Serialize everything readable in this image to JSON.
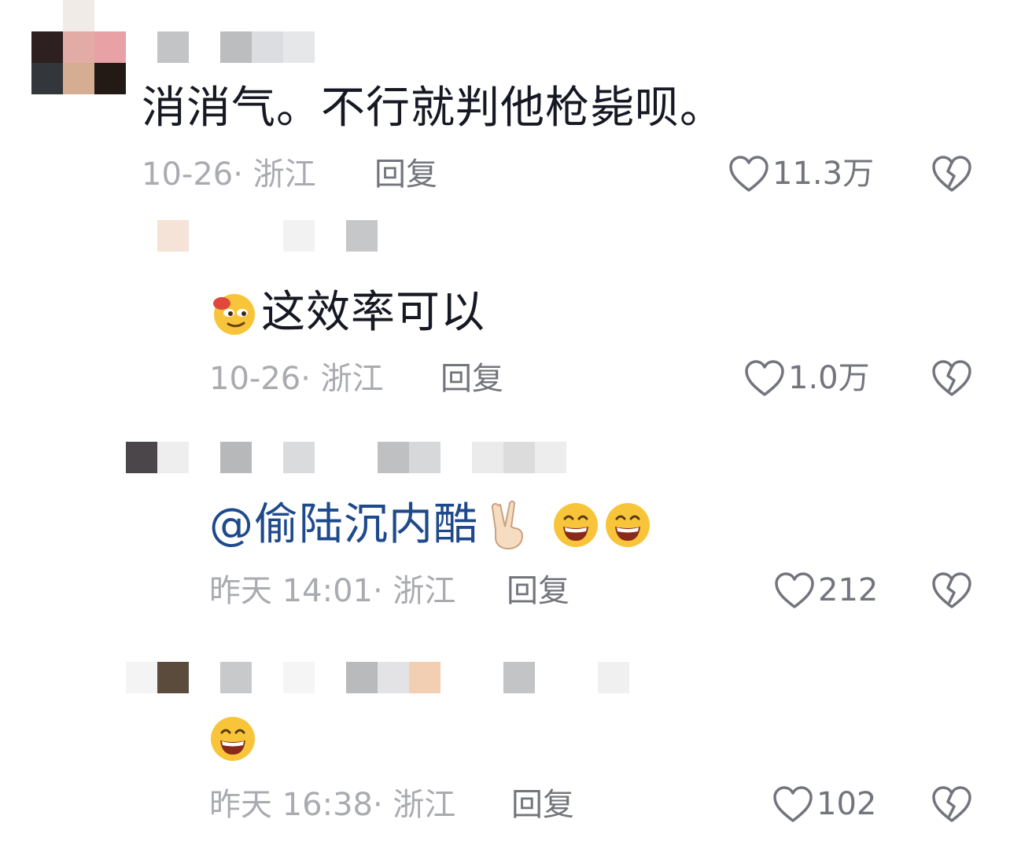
{
  "comments": [
    {
      "text": "消消气。不行就判他枪毙呗。",
      "meta": "10-26· 浙江",
      "reply_label": "回复",
      "likes": "11.3万"
    },
    {
      "text": "这效率可以",
      "emoji_prefix": "melting-drunk-face-emoji",
      "meta": "10-26· 浙江",
      "reply_label": "回复",
      "likes": "1.0万"
    },
    {
      "mention": "@偷陆沉内酷",
      "emoji_suffix": [
        "victory-hand-emoji",
        "grinning-face-emoji",
        "grinning-face-emoji"
      ],
      "meta": "昨天 14:01· 浙江",
      "reply_label": "回复",
      "likes": "212"
    },
    {
      "emoji_only": "grinning-face-emoji",
      "meta": "昨天 16:38· 浙江",
      "reply_label": "回复",
      "likes": "102"
    }
  ],
  "colors": {
    "text": "#161823",
    "meta": "#a9abb0",
    "action": "#73757c",
    "mention": "#1e4a8c"
  }
}
